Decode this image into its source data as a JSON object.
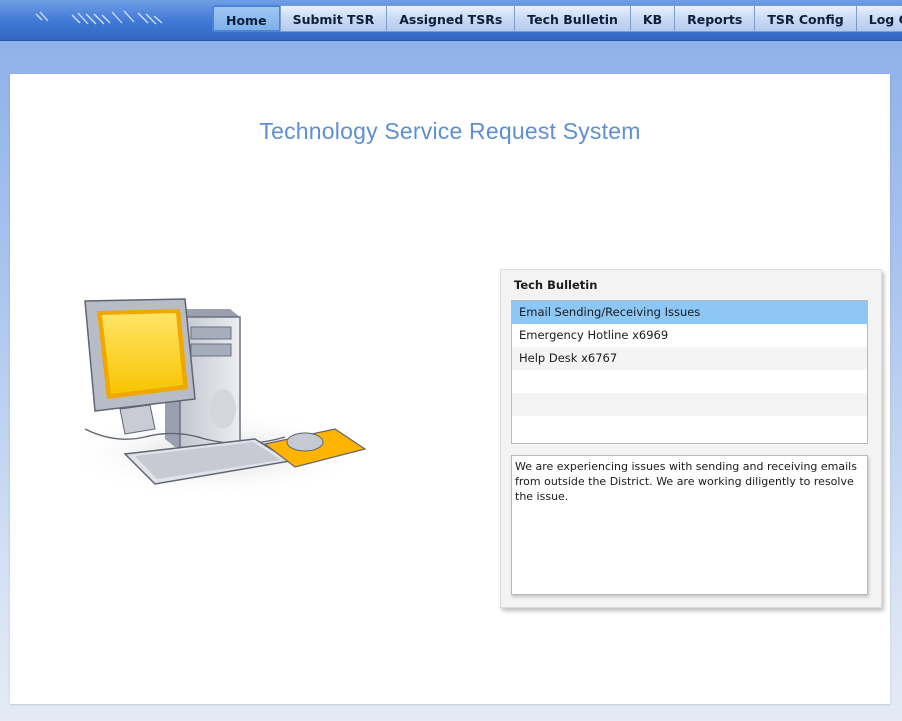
{
  "nav": {
    "items": [
      {
        "label": "Home",
        "active": true
      },
      {
        "label": "Submit TSR",
        "active": false
      },
      {
        "label": "Assigned TSRs",
        "active": false
      },
      {
        "label": "Tech Bulletin",
        "active": false
      },
      {
        "label": "KB",
        "active": false
      },
      {
        "label": "Reports",
        "active": false
      },
      {
        "label": "TSR Config",
        "active": false
      },
      {
        "label": "Log Out",
        "active": false
      }
    ]
  },
  "page": {
    "title": "Technology Service Request System"
  },
  "bulletin": {
    "title": "Tech Bulletin",
    "items": [
      {
        "label": "Email Sending/Receiving Issues",
        "selected": true
      },
      {
        "label": "Emergency Hotline x6969",
        "selected": false
      },
      {
        "label": "Help Desk x6767",
        "selected": false
      }
    ],
    "detail": "We are experiencing issues with sending and receiving emails from outside the District. We are working diligently to resolve the issue."
  },
  "colors": {
    "nav_bar": "#3f78d6",
    "title_blue": "#5e8fd6",
    "selected_row": "#8cc7f5"
  },
  "icons": {
    "illustration": "desktop-computer-illustration",
    "logo": "swoosh-logo"
  }
}
